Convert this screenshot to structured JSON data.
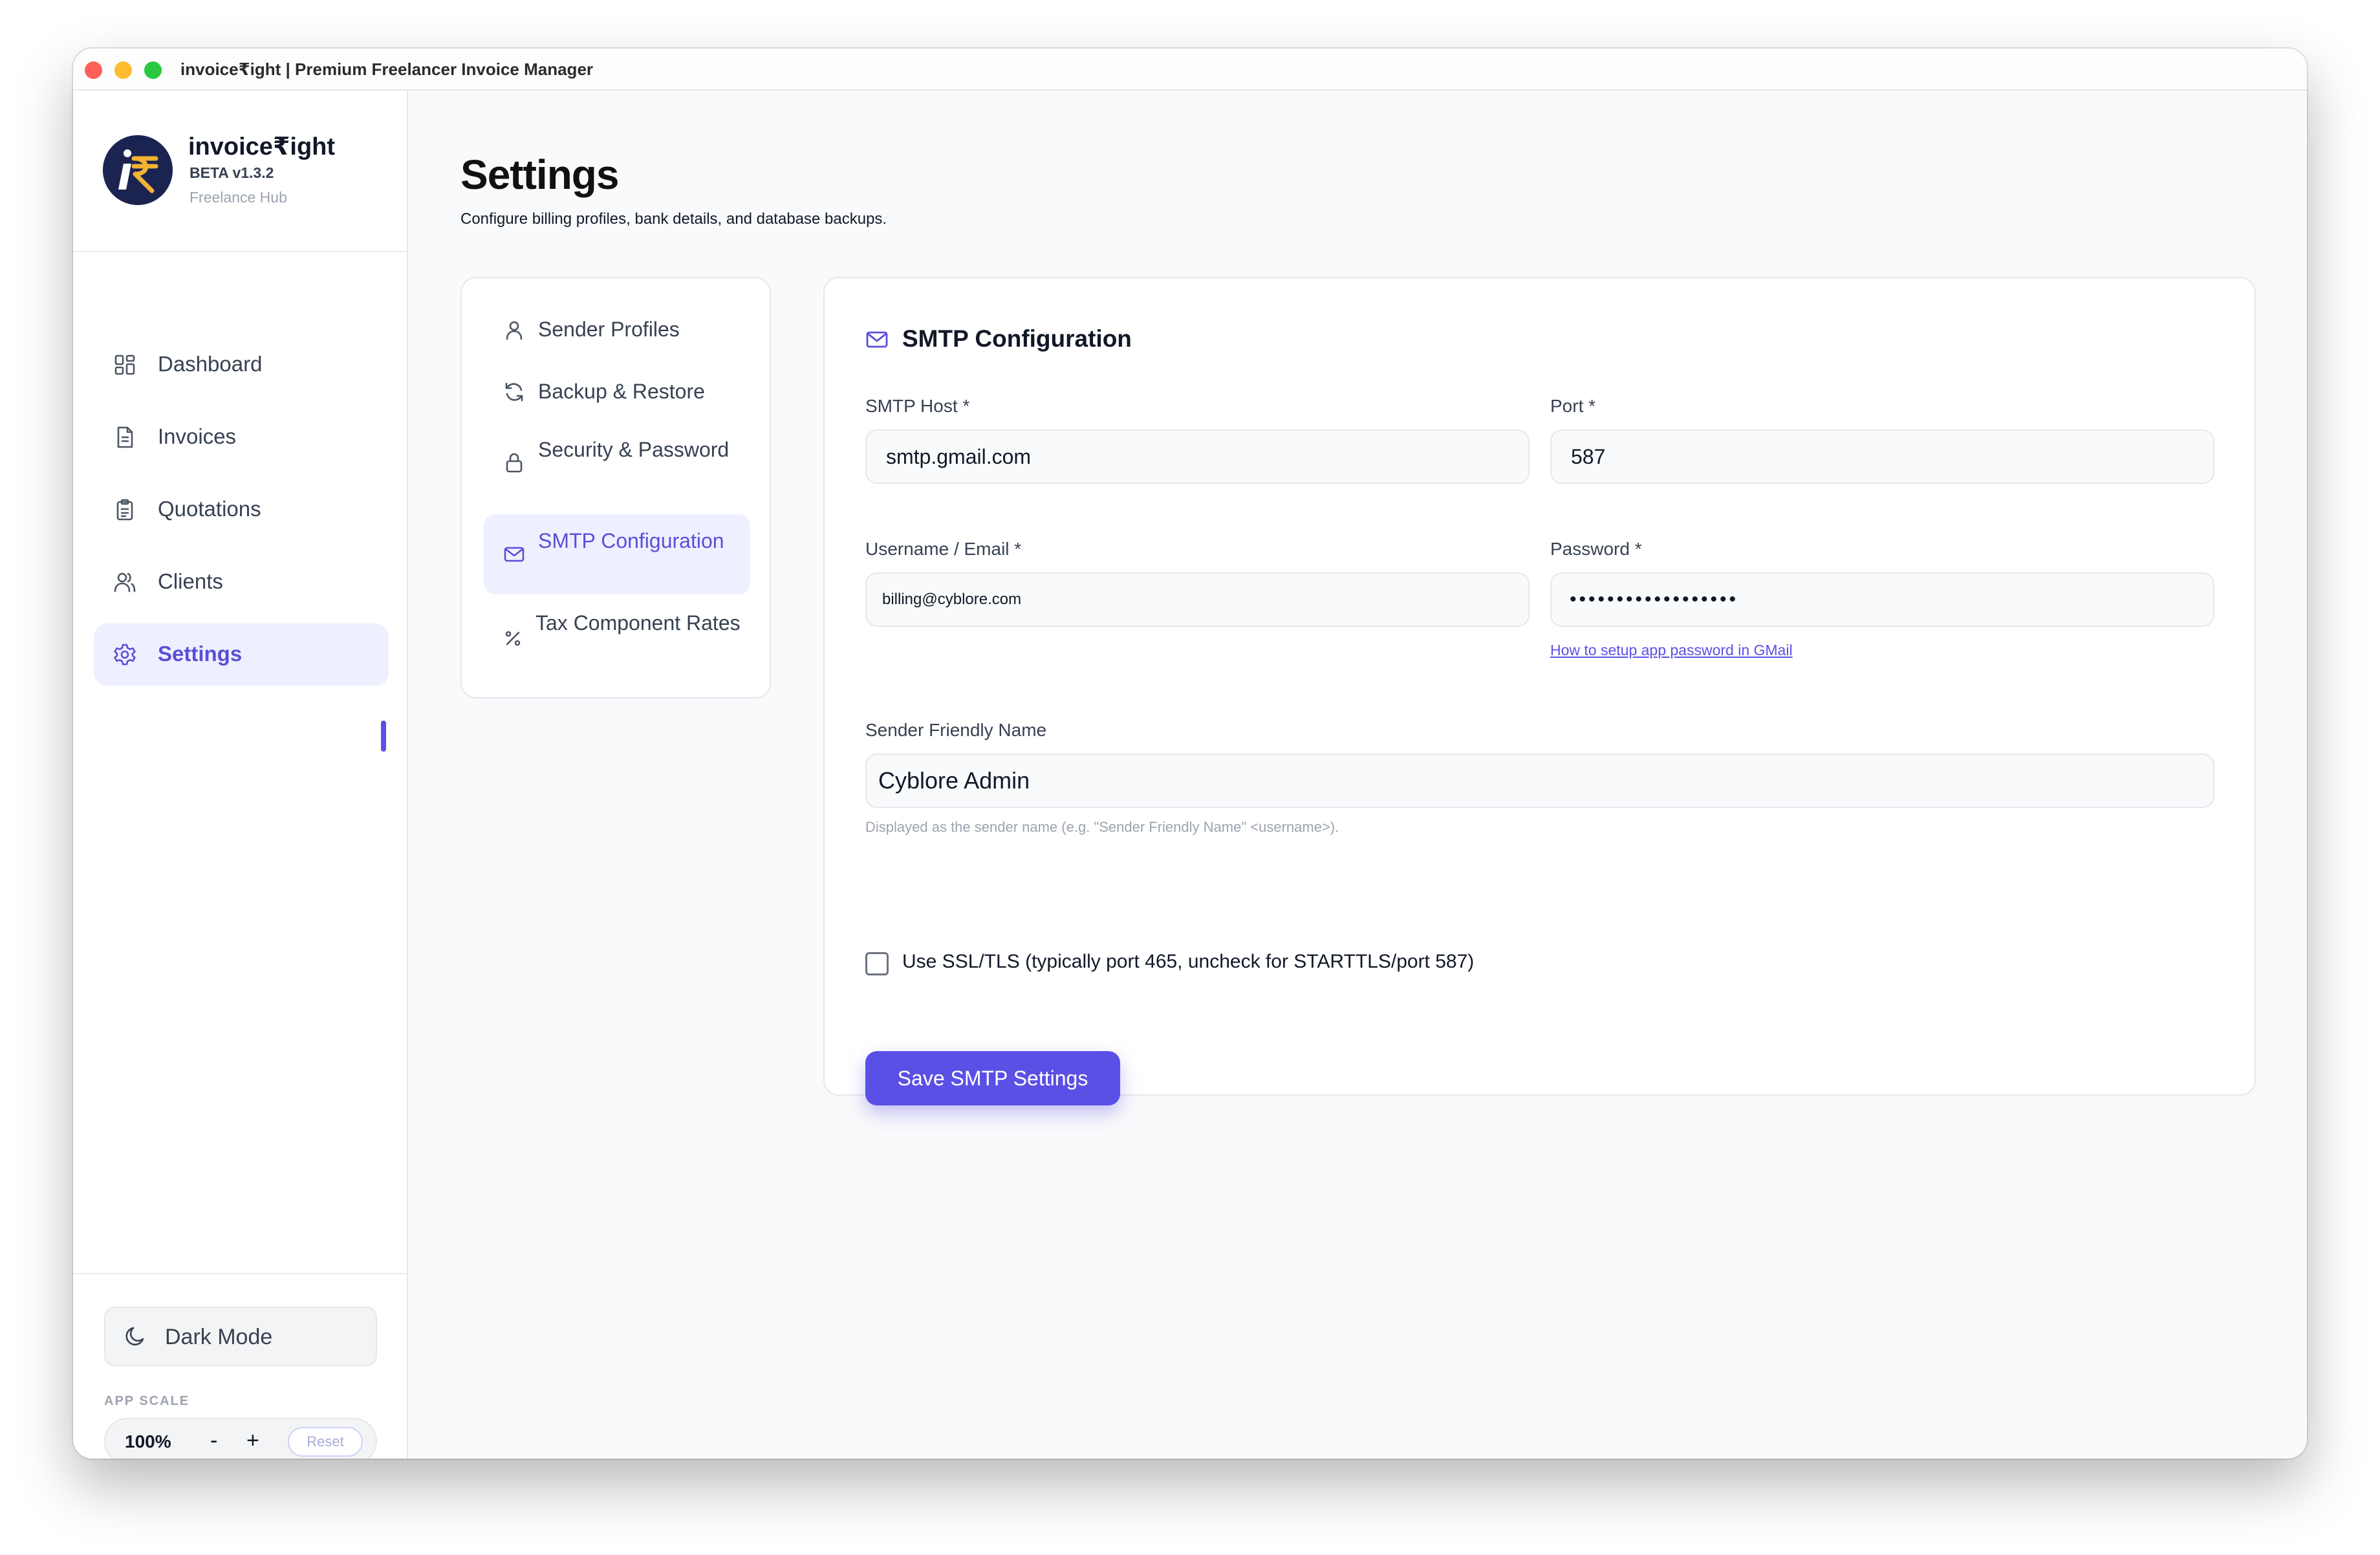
{
  "window": {
    "title": "invoice₹ight | Premium Freelancer Invoice Manager"
  },
  "brand": {
    "name": "invoice₹ight",
    "version": "BETA v1.3.2",
    "subtitle": "Freelance Hub",
    "logo_text": "i₹"
  },
  "sidebar": {
    "items": [
      {
        "label": "Dashboard",
        "icon": "dashboard-icon"
      },
      {
        "label": "Invoices",
        "icon": "document-icon"
      },
      {
        "label": "Quotations",
        "icon": "clipboard-icon"
      },
      {
        "label": "Clients",
        "icon": "users-icon"
      },
      {
        "label": "Settings",
        "icon": "gear-icon",
        "active": true
      }
    ],
    "dark_mode_label": "Dark Mode",
    "app_scale_label": "APP SCALE",
    "scale_value": "100%",
    "scale_minus": "-",
    "scale_plus": "+",
    "scale_reset": "Reset"
  },
  "page": {
    "title": "Settings",
    "subtitle": "Configure billing profiles, bank details, and database backups."
  },
  "subnav": {
    "items": [
      {
        "label": "Sender Profiles",
        "icon": "user-icon"
      },
      {
        "label": "Backup & Restore",
        "icon": "refresh-icon"
      },
      {
        "label": "Security & Password",
        "icon": "lock-icon"
      },
      {
        "label": "SMTP Configuration",
        "icon": "mail-icon",
        "active": true
      },
      {
        "label": "Tax Component Rates",
        "icon": "percent-icon"
      }
    ]
  },
  "smtp": {
    "title": "SMTP Configuration",
    "host_label": "SMTP Host *",
    "host_value": "smtp.gmail.com",
    "port_label": "Port *",
    "port_value": "587",
    "username_label": "Username / Email *",
    "username_value": "billing@cyblore.com",
    "password_label": "Password *",
    "password_value": "••••••••••••••••••",
    "password_help": "How to setup app password in GMail",
    "sender_label": "Sender Friendly Name",
    "sender_value": "Cyblore Admin",
    "sender_hint": "Displayed as the sender name (e.g. \"Sender Friendly Name\" <username>).",
    "ssl_label": "Use SSL/TLS (typically port 465, uncheck for STARTTLS/port 587)",
    "ssl_checked": false,
    "save_label": "Save SMTP Settings"
  },
  "colors": {
    "accent": "#5b50e6",
    "accent_soft": "#eef0ff",
    "logo_bg": "#1b2451",
    "logo_gold": "#f2b233"
  }
}
